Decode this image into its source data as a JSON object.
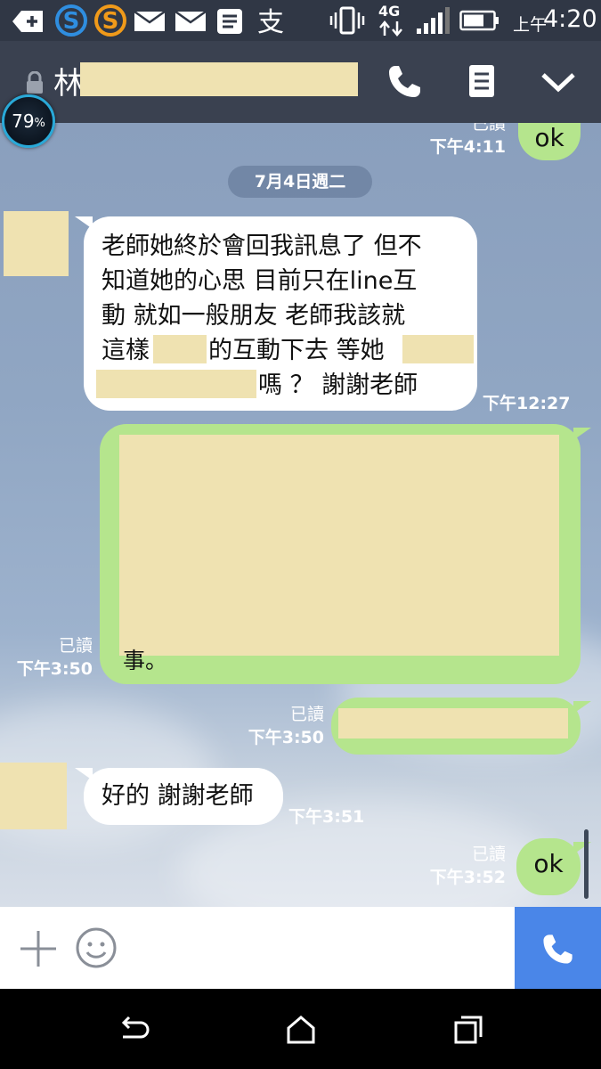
{
  "status_bar": {
    "time": "4:20",
    "am_pm": "上午",
    "network": "4G"
  },
  "header": {
    "contact_name_visible": "林"
  },
  "battery_widget": {
    "percent": "79",
    "unit": "%"
  },
  "chat": {
    "top_partial": {
      "read": "已讀",
      "time": "下午4:11",
      "text": "ok"
    },
    "date_divider": "7月4日週二",
    "messages": [
      {
        "side": "in",
        "lines": [
          "老師她終於會回我訊息了 但不",
          "知道她的心思 目前只在line互",
          "動 就如一般朋友 老師我該就",
          "這樣",
          "的互動下去 等她",
          "嗎 ？ 謝謝老師"
        ],
        "time": "下午12:27"
      },
      {
        "side": "out",
        "visible_tail_text": "事。",
        "read": "已讀",
        "time": "下午3:50"
      },
      {
        "side": "out",
        "read": "已讀",
        "time": "下午3:50"
      },
      {
        "side": "in",
        "text": "好的 謝謝老師",
        "time": "下午3:51"
      },
      {
        "side": "out",
        "text": "ok",
        "read": "已讀",
        "time": "下午3:52"
      }
    ]
  },
  "colors": {
    "header_bg": "#3a4150",
    "status_bg": "#303745",
    "bubble_out": "#b5e58d",
    "bubble_in": "#ffffff",
    "call_button": "#4a86e8",
    "redaction": "#efe2b1"
  },
  "icons": [
    "lock-icon",
    "phone-icon",
    "memo-icon",
    "chevron-down-icon",
    "plus-icon",
    "emoji-icon",
    "back-icon",
    "home-icon",
    "recents-icon"
  ]
}
